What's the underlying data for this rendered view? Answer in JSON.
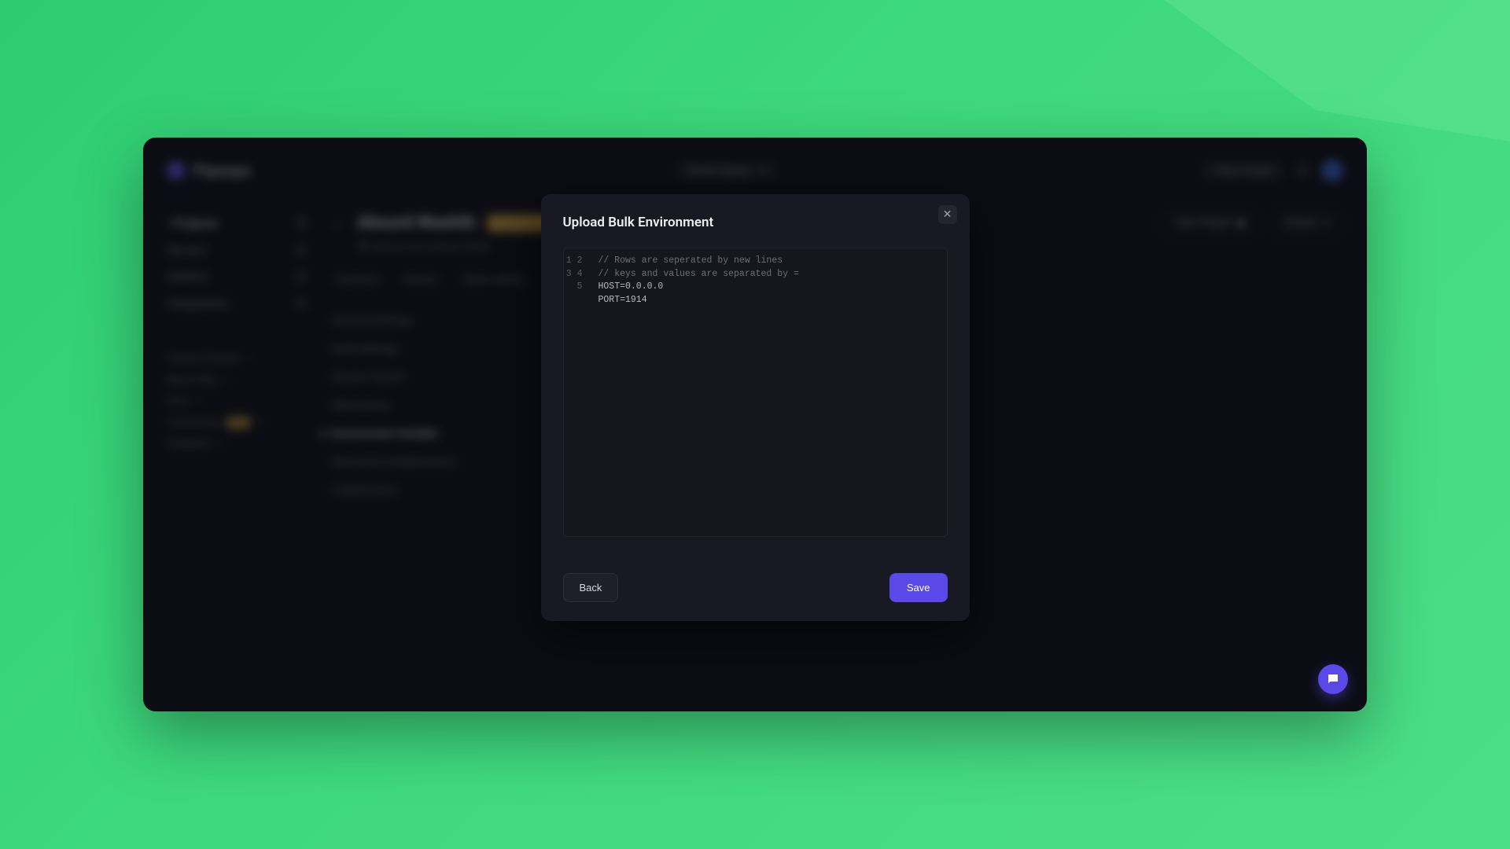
{
  "brand": "Pipeops",
  "header": {
    "space_label": "Daniel Space",
    "new_project": "+ New Project"
  },
  "sidebar": {
    "items": [
      {
        "label": "Projects",
        "count": "7",
        "active": true
      },
      {
        "label": "Servers",
        "count": "0"
      },
      {
        "label": "AddOns",
        "count": "4"
      },
      {
        "label": "Integrations",
        "count": "2"
      }
    ],
    "secondary": [
      {
        "label": "Feature Preview"
      },
      {
        "label": "Report Bug"
      },
      {
        "label": "Docs"
      },
      {
        "label": "Community",
        "badge": "Beta"
      },
      {
        "label": "Feedback"
      }
    ]
  },
  "project": {
    "title": "Absurd Washth",
    "subtitle": "pipeops-dev/pipeops-flaskjs",
    "view_label": "View Project",
    "actions_label": "Actions"
  },
  "tabs": [
    "Overview",
    "History",
    "Observability"
  ],
  "settings_nav": [
    "General Settings",
    "Build Settings",
    "Source Control",
    "Networking",
    "Environment Variable",
    "Resources & Replications",
    "Collaboration"
  ],
  "settings_active_index": 4,
  "modal": {
    "title": "Upload Bulk Environment",
    "lines": [
      "// Rows are seperated by new lines",
      "// keys and values are separated by =",
      "HOST=0.0.0.0",
      "PORT=1914",
      ""
    ],
    "back": "Back",
    "save": "Save"
  }
}
